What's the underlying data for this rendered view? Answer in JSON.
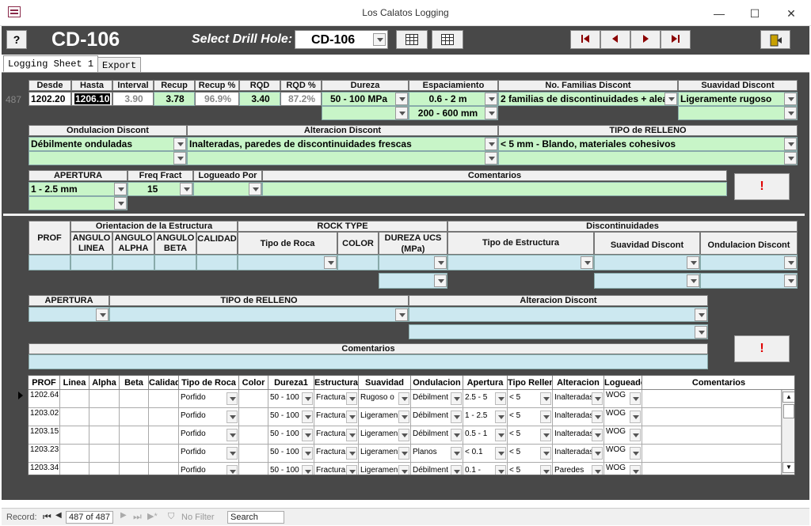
{
  "window": {
    "title": "Los Calatos Logging",
    "minimize": "—",
    "maximize": "☐",
    "close": "✕"
  },
  "header": {
    "hole_title": "CD-106",
    "select_label": "Select Drill Hole:",
    "select_value": "CD-106",
    "help": "?"
  },
  "tabs": [
    "Logging Sheet 1",
    "Export"
  ],
  "interval": {
    "record_num": "487",
    "labels": {
      "desde": "Desde",
      "hasta": "Hasta",
      "interval": "Interval",
      "recup": "Recup",
      "recup_pct": "Recup %",
      "rqd": "RQD",
      "rqd_pct": "RQD %",
      "dureza": "Dureza",
      "espaciamiento": "Espaciamiento",
      "familias": "No. Familias Discont",
      "suavidad": "Suavidad Discont"
    },
    "values": {
      "desde": "1202.20",
      "hasta": "1206.10",
      "interval": "3.90",
      "recup": "3.78",
      "recup_pct": "96.9%",
      "rqd": "3.40",
      "rqd_pct": "87.2%",
      "dureza": "50 - 100 MPa",
      "espaciamiento": "0.6 - 2 m",
      "espaciamiento2": "200 - 600 mm",
      "familias": "2 familias de discontinuidades + alea",
      "suavidad": "Ligeramente rugoso"
    }
  },
  "row2": {
    "labels": {
      "ondulacion": "Ondulacion Discont",
      "alteracion": "Alteracion Discont",
      "relleno": "TIPO de RELLENO"
    },
    "values": {
      "ondulacion": "Débilmente onduladas",
      "alteracion": "Inalteradas, paredes de discontinuidades frescas",
      "relleno": "< 5 mm - Blando, materiales cohesivos"
    }
  },
  "row3": {
    "labels": {
      "apertura": "APERTURA",
      "freq": "Freq Fract",
      "logueado": "Logueado Por",
      "comentarios": "Comentarios"
    },
    "values": {
      "apertura": "1 - 2.5 mm",
      "freq": "15",
      "logueado": "",
      "comentarios": ""
    },
    "flag": "!"
  },
  "structure": {
    "groups": {
      "orient": "Orientacion de la Estructura",
      "rock": "ROCK TYPE",
      "discont": "Discontinuidades"
    },
    "labels": {
      "prof": "PROF",
      "linea": "ANGULO LINEA",
      "alpha": "ANGULO ALPHA",
      "beta": "ANGULO BETA",
      "calidad": "CALIDAD",
      "tipo_roca": "Tipo de Roca",
      "color": "COLOR",
      "dureza": "DUREZA UCS (MPa)",
      "tipo_estr": "Tipo de Estructura",
      "suavidad": "Suavidad Discont",
      "ondulacion": "Ondulacion Discont",
      "apertura": "APERTURA",
      "relleno": "TIPO de RELLENO",
      "alteracion": "Alteracion Discont",
      "comentarios": "Comentarios"
    },
    "flag": "!"
  },
  "grid": {
    "headers": [
      "PROF",
      "Linea",
      "Alpha",
      "Beta",
      "Calidad",
      "Tipo de Roca",
      "Color",
      "Dureza1",
      "Estructura",
      "Suavidad",
      "Ondulacion",
      "Apertura",
      "Tipo Relleno",
      "Alteracion",
      "Logueado",
      "Comentarios"
    ],
    "rows": [
      {
        "prof": "1202.64",
        "roca": "Porfido",
        "dureza": "50 - 100",
        "estr": "Fractura",
        "suav": "Rugoso o",
        "ond": "Débilment",
        "ap": "2.5 - 5",
        "rel": "< 5",
        "alt": "Inalteradas",
        "log": "WOG"
      },
      {
        "prof": "1203.02",
        "roca": "Porfido",
        "dureza": "50 - 100",
        "estr": "Fractura",
        "suav": "Ligeramen",
        "ond": "Débilment",
        "ap": "1 - 2.5",
        "rel": "< 5",
        "alt": "Inalteradas",
        "log": "WOG"
      },
      {
        "prof": "1203.15",
        "roca": "Porfido",
        "dureza": "50 - 100",
        "estr": "Fractura",
        "suav": "Ligeramen",
        "ond": "Débilment",
        "ap": "0.5 - 1",
        "rel": "< 5",
        "alt": "Inalteradas",
        "log": "WOG"
      },
      {
        "prof": "1203.23",
        "roca": "Porfido",
        "dureza": "50 - 100",
        "estr": "Fractura",
        "suav": "Ligeramen",
        "ond": "Planos",
        "ap": "< 0.1",
        "rel": "< 5",
        "alt": "Inalteradas",
        "log": "WOG"
      },
      {
        "prof": "1203.34",
        "roca": "Porfido",
        "dureza": "50 - 100",
        "estr": "Fractura",
        "suav": "Ligeramen",
        "ond": "Débilment",
        "ap": "0.1 -",
        "rel": "< 5",
        "alt": "Paredes",
        "log": "WOG"
      }
    ]
  },
  "status": {
    "record_label": "Record:",
    "record_value": "487 of 487",
    "filter": "No Filter",
    "search": "Search"
  }
}
